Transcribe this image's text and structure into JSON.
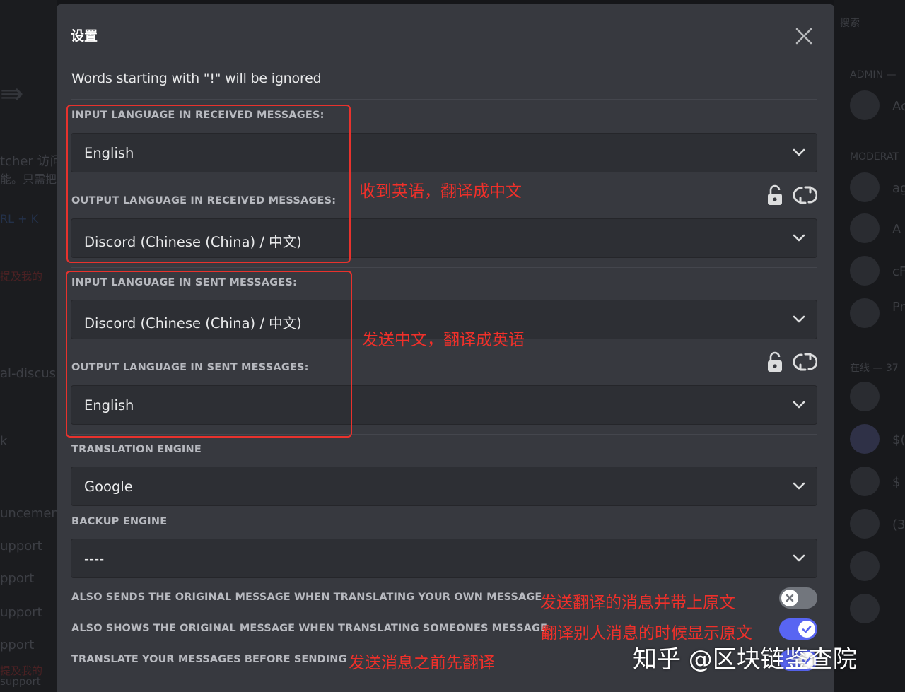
{
  "background": {
    "left_fragments": [
      "tcher 访问",
      "能。只需把",
      "RL + K",
      "提及我的",
      "al-discuss",
      "k",
      "uncemen",
      "upport",
      "pport",
      "upport",
      "pport",
      "提及我的",
      "support"
    ],
    "right_fragments": [
      "搜索",
      "ADMIN —",
      "MODERAT",
      "在线 — 37"
    ],
    "right_avatar_texts": [
      "Ac",
      "ag",
      "A",
      "cF",
      "Pr",
      "$(",
      "$",
      "(3"
    ]
  },
  "modal": {
    "title": "设置",
    "note": "Words starting with \"!\" will be ignored",
    "received": {
      "input_label": "INPUT LANGUAGE IN RECEIVED MESSAGES:",
      "input_value": "English",
      "output_label": "OUTPUT LANGUAGE IN RECEIVED MESSAGES:",
      "output_value": "Discord (Chinese (China) / 中文)"
    },
    "sent": {
      "input_label": "INPUT LANGUAGE IN SENT MESSAGES:",
      "input_value": "Discord (Chinese (China) / 中文)",
      "output_label": "OUTPUT LANGUAGE IN SENT MESSAGES:",
      "output_value": "English"
    },
    "engine": {
      "label": "TRANSLATION ENGINE",
      "value": "Google"
    },
    "backup": {
      "label": "BACKUP ENGINE",
      "value": "----"
    },
    "toggles": [
      {
        "label": "ALSO SENDS THE ORIGINAL MESSAGE WHEN TRANSLATING YOUR OWN MESSAGE",
        "on": false
      },
      {
        "label": "ALSO SHOWS THE ORIGINAL MESSAGE WHEN TRANSLATING SOMEONES MESSAGE",
        "on": true
      },
      {
        "label": "TRANSLATE YOUR MESSAGES BEFORE SENDING",
        "on": true
      }
    ]
  },
  "annotations": {
    "received": "收到英语，翻译成中文",
    "sent": "发送中文，翻译成英语",
    "toggle1": "发送翻译的消息并带上原文",
    "toggle2": "翻译别人消息的时候显示原文",
    "toggle3": "发送消息之前先翻译"
  },
  "watermark": "知乎 @区块链鉴查院",
  "colors": {
    "modal_bg": "#37393f",
    "select_bg": "#2d2f34",
    "annotation_red": "#f0302a",
    "toggle_on": "#5865f2",
    "toggle_off": "#72767d"
  },
  "icons": [
    "close-icon",
    "chevron-down-icon",
    "lock-icon",
    "swap-icon",
    "check-icon",
    "x-icon"
  ]
}
